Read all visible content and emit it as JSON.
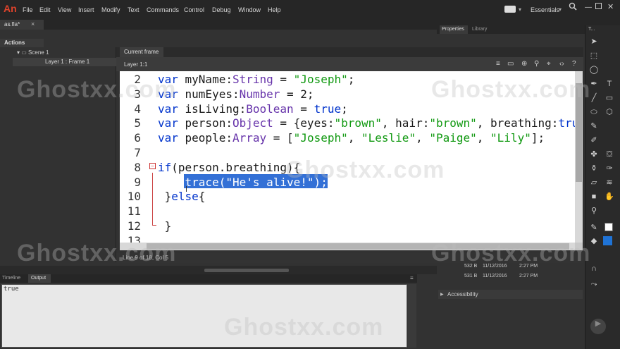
{
  "app": {
    "logo_text": "An",
    "document_tab": "as.fla*",
    "close_glyph": "×"
  },
  "menu": [
    "File",
    "Edit",
    "View",
    "Insert",
    "Modify",
    "Text",
    "Commands",
    "Control",
    "Debug",
    "Window",
    "Help"
  ],
  "workspace": {
    "label": "Essentials"
  },
  "actions_panel": {
    "title": "Actions",
    "tree": {
      "scene": "Scene 1",
      "frame": "Layer 1 : Frame 1"
    }
  },
  "editor": {
    "tab": "Current frame",
    "layer_label": "Layer 1:1",
    "status": "Line 9 of 18, Col 5",
    "line_numbers": [
      "2",
      "3",
      "4",
      "5",
      "6",
      "7",
      "8",
      "9",
      "10",
      "11",
      "12",
      "13"
    ],
    "lines": [
      [
        {
          "t": "var ",
          "c": "kw"
        },
        {
          "t": "myName:"
        },
        {
          "t": "String",
          "c": "ty"
        },
        {
          "t": " = "
        },
        {
          "t": "\"Joseph\"",
          "c": "st"
        },
        {
          "t": ";"
        }
      ],
      [
        {
          "t": "var ",
          "c": "kw"
        },
        {
          "t": "numEyes:"
        },
        {
          "t": "Number",
          "c": "ty"
        },
        {
          "t": " = 2;"
        }
      ],
      [
        {
          "t": "var ",
          "c": "kw"
        },
        {
          "t": "isLiving:"
        },
        {
          "t": "Boolean",
          "c": "ty"
        },
        {
          "t": " = "
        },
        {
          "t": "true",
          "c": "kw"
        },
        {
          "t": ";"
        }
      ],
      [
        {
          "t": "var ",
          "c": "kw"
        },
        {
          "t": "person:"
        },
        {
          "t": "Object",
          "c": "ty"
        },
        {
          "t": " = {eyes:"
        },
        {
          "t": "\"brown\"",
          "c": "st"
        },
        {
          "t": ", hair:"
        },
        {
          "t": "\"brown\"",
          "c": "st"
        },
        {
          "t": ", breathing:"
        },
        {
          "t": "tru",
          "c": "kw"
        }
      ],
      [
        {
          "t": "var ",
          "c": "kw"
        },
        {
          "t": "people:"
        },
        {
          "t": "Array",
          "c": "ty"
        },
        {
          "t": " = ["
        },
        {
          "t": "\"Joseph\"",
          "c": "st"
        },
        {
          "t": ", "
        },
        {
          "t": "\"Leslie\"",
          "c": "st"
        },
        {
          "t": ", "
        },
        {
          "t": "\"Paige\"",
          "c": "st"
        },
        {
          "t": ", "
        },
        {
          "t": "\"Lily\"",
          "c": "st"
        },
        {
          "t": "];"
        }
      ],
      [],
      [
        {
          "t": "if",
          "c": "kw"
        },
        {
          "t": "(person.breathing){"
        }
      ],
      [
        {
          "t": "    trace(\"He's alive!\");",
          "c": "sel"
        }
      ],
      [
        {
          "t": " }"
        },
        {
          "t": "else",
          "c": "kw"
        },
        {
          "t": "{"
        }
      ],
      [],
      [
        {
          "t": " }"
        }
      ],
      []
    ]
  },
  "right_panel": {
    "tabs": [
      "Properties",
      "Library"
    ],
    "library_rows": [
      {
        "size": "532 B",
        "date": "11/12/2016",
        "time": "2:27 PM"
      },
      {
        "size": "531 B",
        "date": "11/12/2016",
        "time": "2:27 PM"
      }
    ],
    "accessibility": "Accessibility"
  },
  "tools": {
    "title": "T..."
  },
  "bottom_panel": {
    "tabs": [
      "Timeline",
      "Output"
    ],
    "output_text": "true"
  },
  "watermark": "Ghostxx.com",
  "colors": {
    "selection": "#3370d6",
    "keyword": "#0033cc",
    "type": "#6633aa",
    "string": "#119911",
    "fill_swatch": "#1f73d6",
    "logo": "#e0432b"
  }
}
